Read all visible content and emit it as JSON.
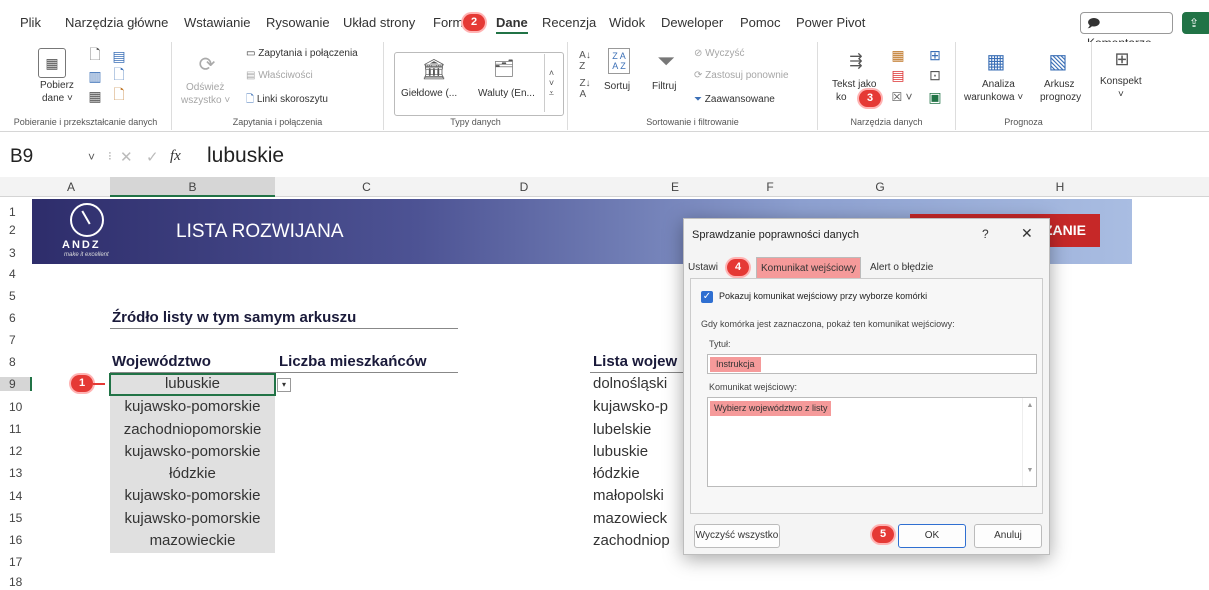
{
  "tabs": [
    "Plik",
    "Narzędzia główne",
    "Wstawianie",
    "Rysowanie",
    "Układ strony",
    "Form",
    "Dane",
    "Recenzja",
    "Widok",
    "Deweloper",
    "Pomoc",
    "Power Pivot"
  ],
  "active_tab": "Dane",
  "top_right": {
    "comments": "Komentarze",
    "share_icon": "share-icon"
  },
  "steps": {
    "s1": "1",
    "s2": "2",
    "s3": "3",
    "s4": "4",
    "s5": "5"
  },
  "ribbon": {
    "g1": {
      "label": "Pobieranie i przekształcanie danych",
      "btn1": "Pobierz",
      "btn2": "dane ˅"
    },
    "g2": {
      "label": "Zapytania i połączenia",
      "refresh1": "Odśwież",
      "refresh2": "wszystko ˅",
      "queries": "Zapytania i połączenia",
      "props": "Właściwości",
      "links": "Linki skoroszytu"
    },
    "g3": {
      "label": "Typy danych",
      "stocks": "Giełdowe (...",
      "currency": "Waluty (En..."
    },
    "g4": {
      "label": "Sortowanie i filtrowanie",
      "sort": "Sortuj",
      "filter": "Filtruj",
      "clear": "Wyczyść",
      "reapply": "Zastosuj ponownie",
      "advanced": "Zaawansowane"
    },
    "g5": {
      "label": "Narzędzia danych",
      "text1": "Tekst jako",
      "text2": "ko"
    },
    "g6": {
      "label": "Prognoza",
      "whatif1": "Analiza",
      "whatif2": "warunkowa ˅",
      "forecast1": "Arkusz",
      "forecast2": "prognozy"
    },
    "g7": {
      "outline": "Konspekt",
      "outline2": "˅"
    }
  },
  "formula": {
    "cell_ref": "B9",
    "fx": "fx",
    "value": "lubuskie"
  },
  "columns": [
    "A",
    "B",
    "C",
    "D",
    "E",
    "F",
    "G",
    "H"
  ],
  "rows": [
    "1",
    "2",
    "3",
    "4",
    "5",
    "6",
    "7",
    "8",
    "9",
    "10",
    "11",
    "12",
    "13",
    "14",
    "15",
    "16",
    "17",
    "18"
  ],
  "banner": {
    "title": "LISTA ROZWIJANA",
    "logo": "ANDZ",
    "logo_tag": "make it excellent",
    "right_btn": "ZANIE"
  },
  "sheet": {
    "section_title": "Źródło listy w tym samym arkuszu",
    "col_b_header": "Województwo",
    "col_c_header": "Liczba mieszkańców",
    "col_e_header": "Lista wojew",
    "col_b": [
      "lubuskie",
      "kujawsko-pomorskie",
      "zachodniopomorskie",
      "kujawsko-pomorskie",
      "łódzkie",
      "kujawsko-pomorskie",
      "kujawsko-pomorskie",
      "mazowieckie"
    ],
    "col_e": [
      "dolnośląski",
      "kujawsko-p",
      "lubelskie",
      "lubuskie",
      "łódzkie",
      "małopolski",
      "mazowieck",
      "zachodniop"
    ]
  },
  "dialog": {
    "title": "Sprawdzanie poprawności danych",
    "help": "?",
    "close": "✕",
    "tab_settings": "Ustawi",
    "tab_input": "Komunikat wejściowy",
    "tab_error": "Alert o błędzie",
    "checkbox_label": "Pokazuj komunikat wejściowy przy wyborze komórki",
    "info": "Gdy komórka jest zaznaczona, pokaż ten komunikat wejściowy:",
    "title_label": "Tytuł:",
    "title_value": "Instrukcja",
    "msg_label": "Komunikat wejściowy:",
    "msg_value": "Wybierz województwo z listy",
    "clear_all": "Wyczyść wszystko",
    "ok": "OK",
    "cancel": "Anuluj"
  },
  "colors": {
    "accent": "#217346",
    "banner_dark": "#2e2d6b",
    "banner_light": "#a9bde2",
    "badge": "#e53935",
    "highlight": "#f59a9a",
    "button_red": "#c62828"
  }
}
